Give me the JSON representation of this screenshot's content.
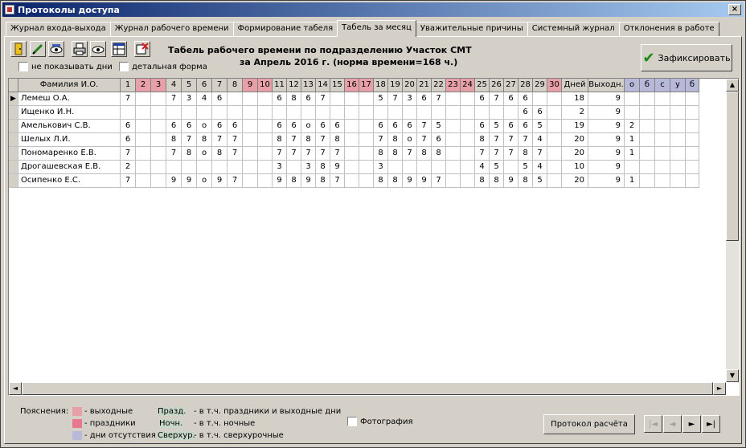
{
  "window": {
    "title": "Протоколы доступа",
    "close": "×"
  },
  "tabs": [
    {
      "label": "Журнал входа-выхода"
    },
    {
      "label": "Журнал рабочего времени"
    },
    {
      "label": "Формирование табеля"
    },
    {
      "label": "Табель за месяц",
      "active": true
    },
    {
      "label": "Уважительные причины"
    },
    {
      "label": "Системный журнал"
    },
    {
      "label": "Отклонения в работе"
    }
  ],
  "header": {
    "line1": "Табель рабочего времени по подразделению  Участок СМТ",
    "line2": "за  Апрель 2016 г.   (норма времени=168 ч.)"
  },
  "options": {
    "hide_days": "не показывать дни",
    "detail_form": "детальная форма"
  },
  "fix_button": "Зафиксировать",
  "table": {
    "name_header": "Фамилия И.О.",
    "days": [
      "1",
      "2",
      "3",
      "4",
      "5",
      "6",
      "7",
      "8",
      "9",
      "10",
      "11",
      "12",
      "13",
      "14",
      "15",
      "16",
      "17",
      "18",
      "19",
      "20",
      "21",
      "22",
      "23",
      "24",
      "25",
      "26",
      "27",
      "28",
      "29",
      "30"
    ],
    "weekend_days": [
      2,
      3,
      9,
      10,
      16,
      17,
      23,
      24,
      30
    ],
    "extra_headers": [
      "Дней",
      "Выходн.",
      "о",
      "б",
      "с",
      "у",
      "б"
    ],
    "rows": [
      {
        "name": "Лемеш О.А.",
        "days": [
          "7",
          "",
          "",
          "7",
          "3",
          "4",
          "6",
          "",
          "",
          "",
          "6",
          "8",
          "6",
          "7",
          "",
          "",
          "",
          "5",
          "7",
          "3",
          "6",
          "7",
          "",
          "",
          "6",
          "7",
          "6",
          "6",
          "",
          "",
          ""
        ],
        "dn": "18",
        "vy": "9",
        "o": ""
      },
      {
        "name": "Ищенко И.Н.",
        "days": [
          "",
          "",
          "",
          "",
          "",
          "",
          "",
          "",
          "",
          "",
          "",
          "",
          "",
          "",
          "",
          "",
          "",
          "",
          "",
          "",
          "",
          "",
          "",
          "",
          "",
          "",
          "",
          "6",
          "6",
          "",
          ""
        ],
        "dn": "2",
        "vy": "9",
        "o": ""
      },
      {
        "name": "Амелькович С.В.",
        "days": [
          "6",
          "",
          "",
          "6",
          "6",
          "о",
          "6",
          "6",
          "",
          "",
          "6",
          "6",
          "о",
          "6",
          "6",
          "",
          "",
          "6",
          "6",
          "6",
          "7",
          "5",
          "",
          "",
          "6",
          "5",
          "6",
          "6",
          "5",
          "",
          ""
        ],
        "dn": "19",
        "vy": "9",
        "o": "2"
      },
      {
        "name": "Шелых Л.И.",
        "days": [
          "6",
          "",
          "",
          "8",
          "7",
          "8",
          "7",
          "7",
          "",
          "",
          "8",
          "7",
          "8",
          "7",
          "8",
          "",
          "",
          "7",
          "8",
          "о",
          "7",
          "6",
          "",
          "",
          "8",
          "7",
          "7",
          "7",
          "4",
          "",
          ""
        ],
        "dn": "20",
        "vy": "9",
        "o": "1"
      },
      {
        "name": "Пономаренко Е.В.",
        "days": [
          "7",
          "",
          "",
          "7",
          "8",
          "о",
          "8",
          "7",
          "",
          "",
          "7",
          "7",
          "7",
          "7",
          "7",
          "",
          "",
          "8",
          "8",
          "7",
          "8",
          "8",
          "",
          "",
          "7",
          "7",
          "7",
          "8",
          "7",
          "",
          ""
        ],
        "dn": "20",
        "vy": "9",
        "o": "1"
      },
      {
        "name": "Дрогашевская Е.В.",
        "days": [
          "2",
          "",
          "",
          "",
          "",
          "",
          "",
          "",
          "",
          "",
          "3",
          "",
          "3",
          "8",
          "9",
          "",
          "",
          "3",
          "",
          "",
          "",
          "",
          "",
          "",
          "4",
          "5",
          "",
          "5",
          "4",
          "",
          ""
        ],
        "dn": "10",
        "vy": "9",
        "o": ""
      },
      {
        "name": "Осипенко Е.С.",
        "days": [
          "7",
          "",
          "",
          "9",
          "9",
          "о",
          "9",
          "7",
          "",
          "",
          "9",
          "8",
          "9",
          "8",
          "7",
          "",
          "",
          "8",
          "8",
          "9",
          "9",
          "7",
          "",
          "",
          "8",
          "8",
          "9",
          "8",
          "5",
          "",
          ""
        ],
        "dn": "20",
        "vy": "9",
        "o": "1"
      }
    ]
  },
  "legend": {
    "title": "Пояснения:",
    "items": [
      "- выходные",
      "- праздники",
      "- дни отсутствия"
    ],
    "abbr": [
      {
        "short": "Празд.",
        "desc": "- в т.ч. праздники и выходные дни"
      },
      {
        "short": "Ночн.",
        "desc": "- в т.ч. ночные"
      },
      {
        "short": "Сверхур.",
        "desc": "- в т.ч. сверхурочные"
      }
    ],
    "colors": {
      "weekend": "#e8a0a8",
      "holiday": "#e87890",
      "absence": "#b8b8d8"
    }
  },
  "photo": "Фотография",
  "protocol_button": "Протокол расчёта",
  "nav": {
    "first": "|◄",
    "prev": "◄",
    "next": "►",
    "last": "►|"
  }
}
